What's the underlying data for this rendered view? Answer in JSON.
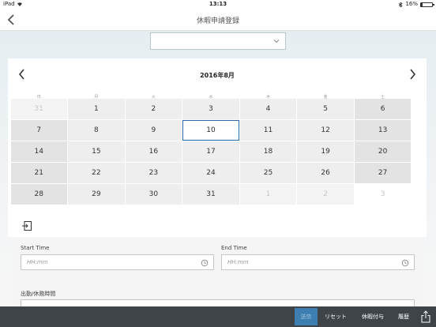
{
  "status": {
    "carrier": "iPad",
    "time": "13:13",
    "battery": "16%"
  },
  "nav": {
    "title": "休暇申請登録"
  },
  "select": {
    "value": ""
  },
  "calendar": {
    "month_label": "2016年8月",
    "weekdays": [
      "日",
      "月",
      "火",
      "水",
      "木",
      "金",
      "土"
    ],
    "selected": "10",
    "weeks": [
      [
        "31",
        "1",
        "2",
        "3",
        "4",
        "5",
        "6"
      ],
      [
        "7",
        "8",
        "9",
        "10",
        "11",
        "12",
        "13"
      ],
      [
        "14",
        "15",
        "16",
        "17",
        "18",
        "19",
        "20"
      ],
      [
        "21",
        "22",
        "23",
        "24",
        "25",
        "26",
        "27"
      ],
      [
        "28",
        "29",
        "30",
        "31",
        "1",
        "2",
        "3"
      ]
    ]
  },
  "form": {
    "start_label": "Start Time",
    "start_placeholder": "HH:mm",
    "end_label": "End Time",
    "end_placeholder": "HH:mm",
    "attendance_label": "出勤/休務時間"
  },
  "footer": {
    "send": "送信",
    "reset": "リセット",
    "grant": "休暇付与",
    "history": "履歴"
  },
  "colors": {
    "accent": "#2a6aa8",
    "footer_bg": "#3f4448",
    "send_bg": "#3c7fb0"
  }
}
